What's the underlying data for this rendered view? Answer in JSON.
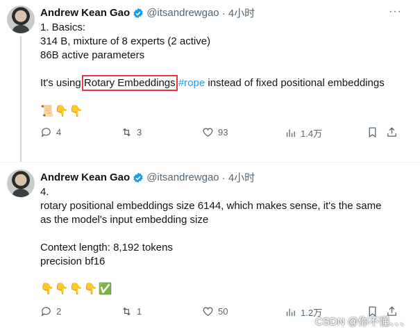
{
  "tweets": [
    {
      "author_name": "Andrew Kean Gao",
      "handle": "@itsandrewgao",
      "time": "· 4小时",
      "lines": [
        "1. Basics:",
        "314 B, mixture of 8 experts (2 active)",
        "86B active parameters"
      ],
      "text_prefix": "It's using ",
      "text_highlight": "Rotary Embeddings",
      "hashtag": "#rope",
      "text_suffix": " instead of fixed positional embeddings",
      "emoji": "📜👇👇",
      "replies": "4",
      "retweets": "3",
      "likes": "93",
      "views": "1.4万"
    },
    {
      "author_name": "Andrew Kean Gao",
      "handle": "@itsandrewgao",
      "time": "· 4小时",
      "lines": [
        "4.",
        "rotary positional embeddings size 6144, which makes sense, it's the same",
        "as the model's input embedding size",
        "",
        "Context length: 8,192 tokens",
        "precision bf16"
      ],
      "emoji": "👇👇👇👇✅",
      "replies": "2",
      "retweets": "1",
      "likes": "50",
      "views": "1.2万"
    }
  ],
  "more_label": "···",
  "watermark": "CSDN @你不懂、、、",
  "colors": {
    "accent": "#1d9bf0",
    "highlight_box": "#e0393e",
    "muted": "#536471"
  }
}
